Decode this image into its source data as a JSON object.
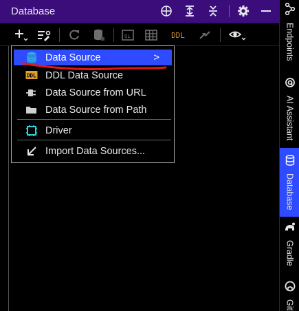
{
  "window": {
    "title": "Database"
  },
  "header": {
    "buttons": [
      {
        "name": "globe-icon"
      },
      {
        "name": "expand-all-icon"
      },
      {
        "name": "collapse-all-icon"
      },
      {
        "name": "gear-icon"
      },
      {
        "name": "minimize-icon"
      }
    ]
  },
  "toolbar": {
    "buttons": [
      "add-icon",
      "data-source-properties-icon",
      "refresh-icon",
      "db-schema-icon",
      "query-console-icon",
      "table-icon",
      "ddl-icon",
      "jump-icon",
      "view-options-icon"
    ],
    "ddl_label": "DDL"
  },
  "menu": {
    "items": [
      {
        "label": "Data Source",
        "icon": "database-icon",
        "selected": true,
        "has_submenu": true
      },
      {
        "label": "DDL Data Source",
        "icon": "ddl-icon"
      },
      {
        "label": "Data Source from URL",
        "icon": "plug-icon"
      },
      {
        "label": "Data Source from Path",
        "icon": "folder-icon"
      },
      {
        "label": "Driver",
        "icon": "driver-icon"
      },
      {
        "label": "Import Data Sources...",
        "icon": "import-arrow-icon"
      }
    ],
    "submenu_chevron": ">",
    "ddl_icon_text": "DDL"
  },
  "right_strip": {
    "items": [
      {
        "label": "Endpoints",
        "icon": "endpoints-icon"
      },
      {
        "label": "AI Assistant",
        "icon": "ai-icon"
      },
      {
        "label": "Database",
        "icon": "database-icon",
        "active": true
      },
      {
        "label": "Gradle",
        "icon": "gradle-icon"
      },
      {
        "label": "Gith",
        "icon": "github-icon"
      }
    ]
  },
  "colors": {
    "header_bg": "#3b0d7a",
    "selection": "#2f4bff",
    "annotation_red": "#e01a1a"
  }
}
